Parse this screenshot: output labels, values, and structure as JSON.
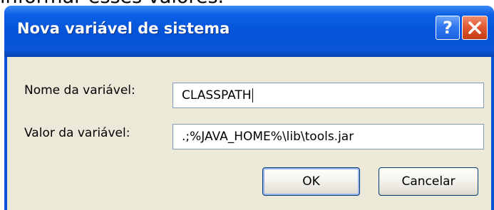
{
  "page": {
    "caption_text": "informar esses valores."
  },
  "window": {
    "title": "Nova variável de sistema",
    "help_button_glyph": "?",
    "close_button_icon": "close-icon"
  },
  "form": {
    "name_label": "Nome da variável:",
    "name_value": "CLASSPATH",
    "value_label": "Valor da variável:",
    "value_value": ".;%JAVA_HOME%\\lib\\tools.jar"
  },
  "buttons": {
    "ok_label": "OK",
    "cancel_label": "Cancelar"
  },
  "colors": {
    "titlebar": "#0453d8",
    "client_background": "#ece9d8",
    "close_button": "#e15a34",
    "field_border": "#7f9db9"
  }
}
